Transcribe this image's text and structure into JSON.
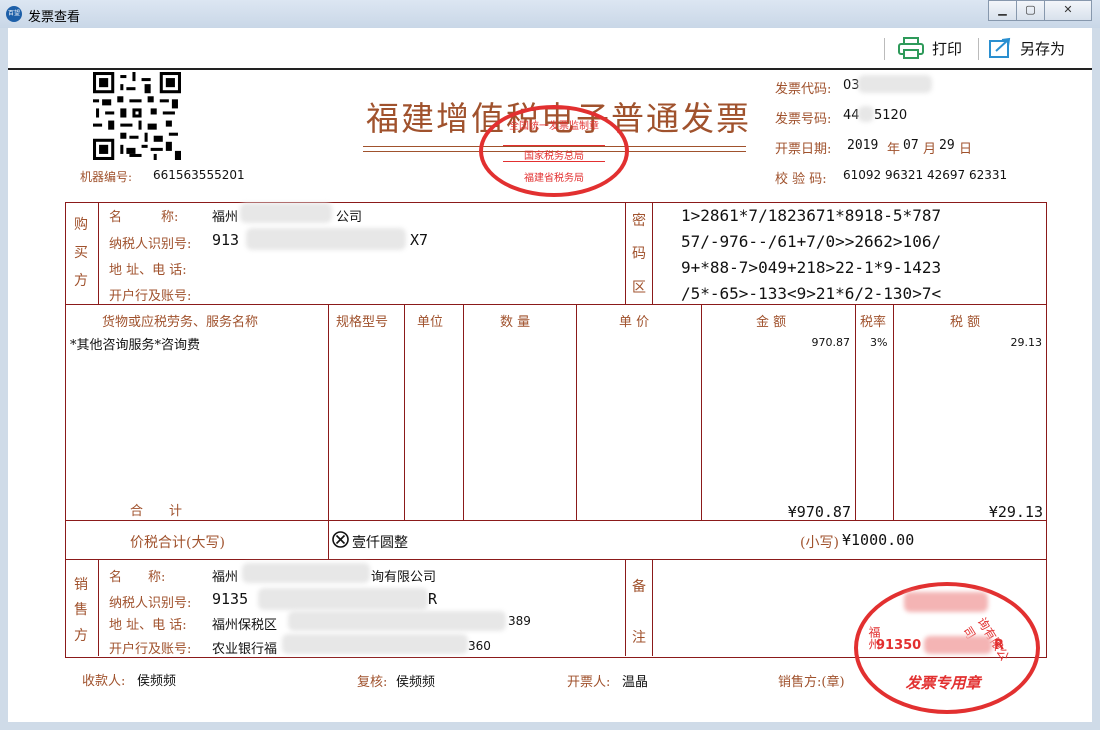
{
  "window": {
    "title": "发票查看",
    "logo_text": "百望",
    "min_icon": "minimize-icon",
    "max_icon": "maximize-icon",
    "close_icon": "close-icon"
  },
  "toolbar": {
    "print_label": "打印",
    "saveas_label": "另存为"
  },
  "invoice": {
    "title": "福建增值税电子普通发票",
    "machine_label": "机器编号:",
    "machine_no": "661563555201",
    "code_label": "发票代码:",
    "code_value": "03",
    "number_label": "发票号码:",
    "number_value": "44",
    "number_tail": "5120",
    "date_label": "开票日期:",
    "date_year": "2019",
    "date_y": "年",
    "date_month": "07",
    "date_m": "月",
    "date_day": "29",
    "date_d": "日",
    "check_label": "校 验 码:",
    "check_value": "61092 96321 42697 62331",
    "buyer": {
      "side": [
        "购",
        "买",
        "方"
      ],
      "name_label": "名　　　称:",
      "name_head": "福州",
      "name_tail": "公司",
      "tax_label": "纳税人识别号:",
      "tax_head": "913",
      "tax_tail": "X7",
      "addr_label": "地 址、电 话:",
      "bank_label": "开户行及账号:"
    },
    "cipher": {
      "side": [
        "密",
        "码",
        "区"
      ],
      "lines": [
        "1>2861*7/1823671*8918-5*787",
        "57/-976--/61+7/0>>2662>106/",
        "9+*88-7>049+218>22-1*9-1423",
        "/5*-65>-133<9>21*6/2-130>7<"
      ]
    },
    "items": {
      "headers": [
        "货物或应税劳务、服务名称",
        "规格型号",
        "单位",
        "数 量",
        "单 价",
        "金 额",
        "税率",
        "税 额"
      ],
      "rows": [
        {
          "name": "*其他咨询服务*咨询费",
          "amount": "970.87",
          "rate": "3%",
          "tax": "29.13"
        }
      ],
      "total_label": "合　　计",
      "total_amount": "¥970.87",
      "total_tax": "¥29.13"
    },
    "sum": {
      "label": "价税合计(大写)",
      "words": "壹仟圆整",
      "small_label": "(小写)",
      "small_value": "¥1000.00"
    },
    "seller": {
      "side": [
        "销",
        "售",
        "方"
      ],
      "name_label": "名　　称:",
      "name_head": "福州",
      "name_tail": "询有限公司",
      "tax_label": "纳税人识别号:",
      "tax_head": "9135",
      "tax_tail": "R",
      "addr_label": "地 址、电 话:",
      "addr_head": "福州保税区",
      "addr_tail": "389",
      "bank_label": "开户行及账号:",
      "bank_head": "农业银行福",
      "bank_tail": "360"
    },
    "remark": {
      "side": [
        "备",
        "注"
      ]
    },
    "footer": {
      "payee_label": "收款人:",
      "payee": "侯频频",
      "review_label": "复核:",
      "review": "侯频频",
      "drawer_label": "开票人:",
      "drawer": "温晶",
      "seller_label": "销售方:(章)"
    },
    "stamp_top": {
      "line1": "全国统一发票监制章",
      "line2": "国家税务总局",
      "line3": "福建省税务局"
    },
    "stamp_seller": {
      "ring_head": "福州",
      "ring_tail": "询有限公司",
      "id_head": "91350",
      "id_tail": "R",
      "bottom": "发票专用章"
    }
  },
  "colors": {
    "frame": "#8b1a1a",
    "label": "#a0522d",
    "stamp": "#e23030"
  }
}
